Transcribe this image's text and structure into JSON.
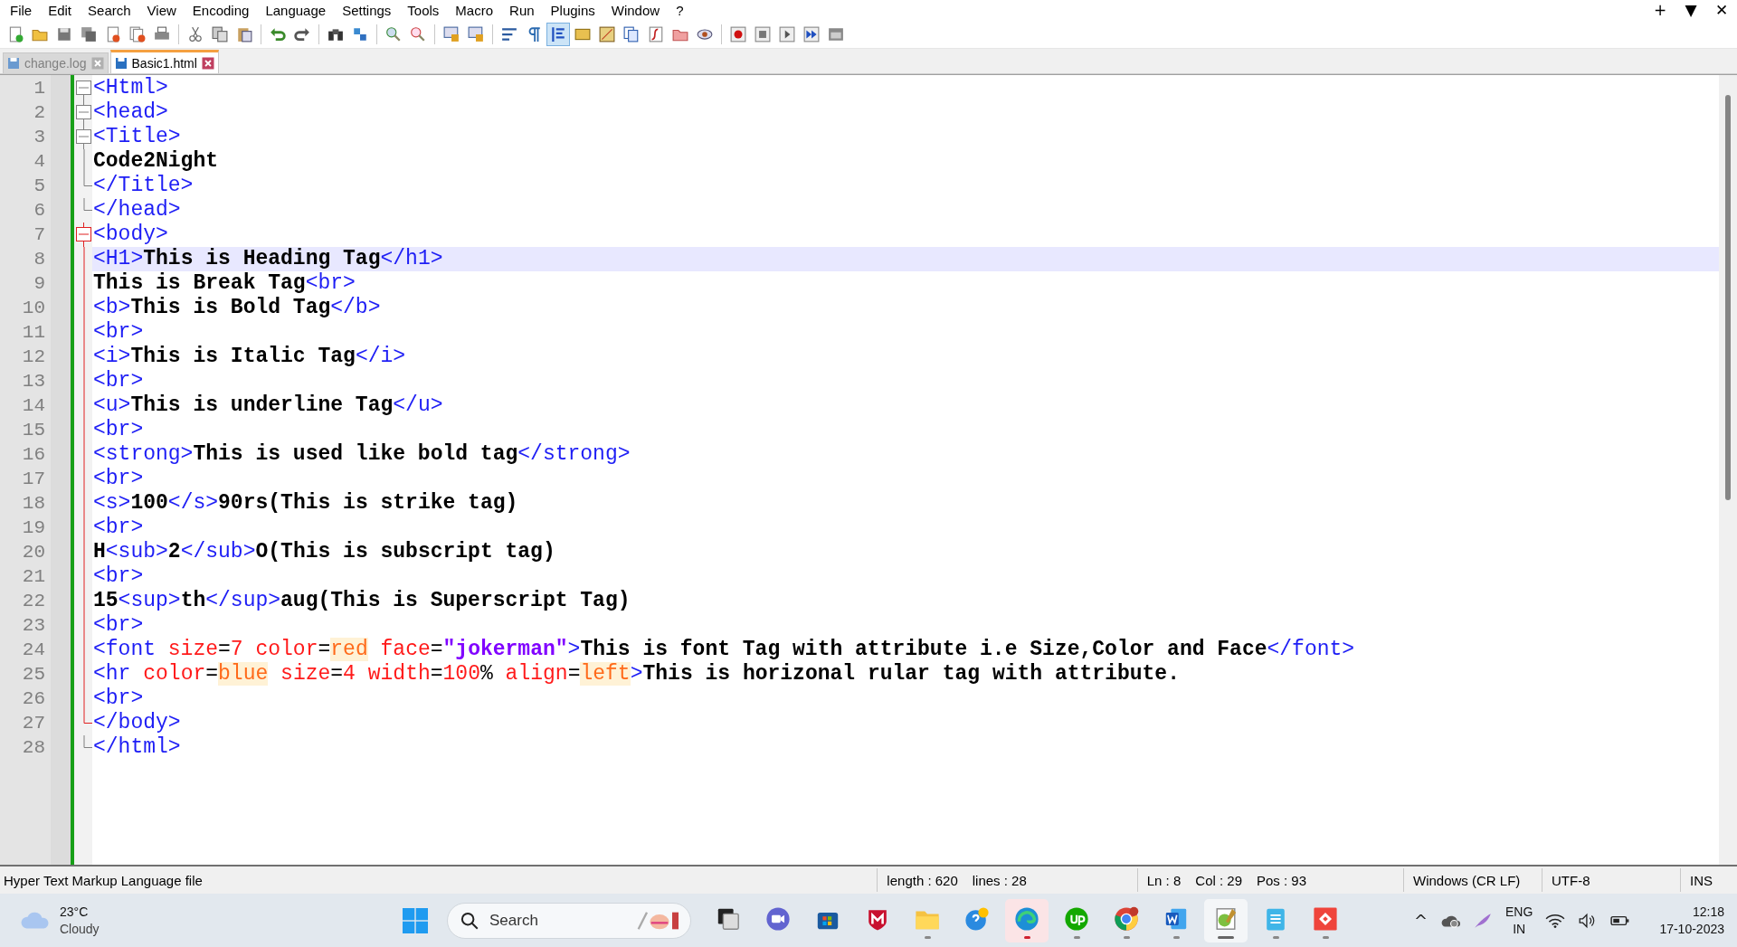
{
  "menu": [
    "File",
    "Edit",
    "Search",
    "View",
    "Encoding",
    "Language",
    "Settings",
    "Tools",
    "Macro",
    "Run",
    "Plugins",
    "Window",
    "?"
  ],
  "window_controls": [
    "+",
    "▼",
    "✕"
  ],
  "toolbar_buttons": [
    {
      "pressed": false
    },
    {
      "pressed": false
    },
    {
      "pressed": false
    },
    {
      "pressed": false
    },
    {
      "pressed": false
    },
    {
      "pressed": false
    },
    {
      "pressed": false
    },
    {
      "pressed": false
    },
    {
      "pressed": false
    },
    {
      "pressed": false
    },
    {
      "pressed": false
    },
    {
      "pressed": false
    },
    {
      "pressed": false
    },
    {
      "pressed": false
    },
    {
      "pressed": false
    },
    {
      "pressed": false
    },
    {
      "pressed": false
    },
    {
      "pressed": false
    },
    {
      "pressed": false
    },
    {
      "pressed": false
    },
    {
      "pressed": true
    },
    {
      "pressed": false
    },
    {
      "pressed": false
    },
    {
      "pressed": false
    },
    {
      "pressed": false
    },
    {
      "pressed": false
    },
    {
      "pressed": false
    },
    {
      "pressed": false
    },
    {
      "pressed": false
    },
    {
      "pressed": false
    },
    {
      "pressed": false
    },
    {
      "pressed": false
    }
  ],
  "tabs": [
    {
      "label": "change.log",
      "selected": false
    },
    {
      "label": "Basic1.html",
      "selected": true
    }
  ],
  "lines": [
    {
      "number": "1",
      "current": false,
      "fold_start": true,
      "fold_active": false,
      "tokens": [
        {
          "kind": "tag",
          "text": "<Html>"
        }
      ]
    },
    {
      "number": "2",
      "current": false,
      "fold_start": true,
      "fold_active": false,
      "tokens": [
        {
          "kind": "tag",
          "text": "<head>"
        }
      ]
    },
    {
      "number": "3",
      "current": false,
      "fold_start": true,
      "fold_active": false,
      "tokens": [
        {
          "kind": "tag",
          "text": "<Title>"
        }
      ]
    },
    {
      "number": "4",
      "current": false,
      "fold_start": false,
      "fold_end": false,
      "fold_active": false,
      "tokens": [
        {
          "kind": "text",
          "text": "Code2Night"
        }
      ]
    },
    {
      "number": "5",
      "current": false,
      "fold_start": false,
      "fold_end": true,
      "fold_active": false,
      "tokens": [
        {
          "kind": "tag",
          "text": "</Title>"
        }
      ]
    },
    {
      "number": "6",
      "current": false,
      "fold_start": false,
      "fold_end": true,
      "fold_active": false,
      "tokens": [
        {
          "kind": "tag",
          "text": "</head>"
        }
      ]
    },
    {
      "number": "7",
      "current": false,
      "fold_start": true,
      "fold_active": true,
      "tokens": [
        {
          "kind": "tag",
          "text": "<body>"
        }
      ]
    },
    {
      "number": "8",
      "current": true,
      "fold_start": false,
      "fold_end": false,
      "fold_active": true,
      "tokens": [
        {
          "kind": "tag",
          "text": "<H1>"
        },
        {
          "kind": "text",
          "text": "This is Heading Tag"
        },
        {
          "kind": "tag",
          "text": "</h1>"
        }
      ]
    },
    {
      "number": "9",
      "current": false,
      "fold_start": false,
      "fold_end": false,
      "fold_active": true,
      "tokens": [
        {
          "kind": "text",
          "text": "This is Break Tag"
        },
        {
          "kind": "tag",
          "text": "<br>"
        }
      ]
    },
    {
      "number": "10",
      "current": false,
      "fold_start": false,
      "fold_end": false,
      "fold_active": true,
      "tokens": [
        {
          "kind": "tag",
          "text": "<b>"
        },
        {
          "kind": "text",
          "text": "This is Bold Tag"
        },
        {
          "kind": "tag",
          "text": "</b>"
        }
      ]
    },
    {
      "number": "11",
      "current": false,
      "fold_start": false,
      "fold_end": false,
      "fold_active": true,
      "tokens": [
        {
          "kind": "tag",
          "text": "<br>"
        }
      ]
    },
    {
      "number": "12",
      "current": false,
      "fold_start": false,
      "fold_end": false,
      "fold_active": true,
      "tokens": [
        {
          "kind": "tag",
          "text": "<i>"
        },
        {
          "kind": "text",
          "text": "This is Italic Tag"
        },
        {
          "kind": "tag",
          "text": "</i>"
        }
      ]
    },
    {
      "number": "13",
      "current": false,
      "fold_start": false,
      "fold_end": false,
      "fold_active": true,
      "tokens": [
        {
          "kind": "tag",
          "text": "<br>"
        }
      ]
    },
    {
      "number": "14",
      "current": false,
      "fold_start": false,
      "fold_end": false,
      "fold_active": true,
      "tokens": [
        {
          "kind": "tag",
          "text": "<u>"
        },
        {
          "kind": "text",
          "text": "This is underline Tag"
        },
        {
          "kind": "tag",
          "text": "</u>"
        }
      ]
    },
    {
      "number": "15",
      "current": false,
      "fold_start": false,
      "fold_end": false,
      "fold_active": true,
      "tokens": [
        {
          "kind": "tag",
          "text": "<br>"
        }
      ]
    },
    {
      "number": "16",
      "current": false,
      "fold_start": false,
      "fold_end": false,
      "fold_active": true,
      "tokens": [
        {
          "kind": "tag",
          "text": "<strong>"
        },
        {
          "kind": "text",
          "text": "This is used like bold tag"
        },
        {
          "kind": "tag",
          "text": "</strong>"
        }
      ]
    },
    {
      "number": "17",
      "current": false,
      "fold_start": false,
      "fold_end": false,
      "fold_active": true,
      "tokens": [
        {
          "kind": "tag",
          "text": "<br>"
        }
      ]
    },
    {
      "number": "18",
      "current": false,
      "fold_start": false,
      "fold_end": false,
      "fold_active": true,
      "tokens": [
        {
          "kind": "tag",
          "text": "<s>"
        },
        {
          "kind": "text",
          "text": "100"
        },
        {
          "kind": "tag",
          "text": "</s>"
        },
        {
          "kind": "text",
          "text": "90rs(This is strike tag)"
        }
      ]
    },
    {
      "number": "19",
      "current": false,
      "fold_start": false,
      "fold_end": false,
      "fold_active": true,
      "tokens": [
        {
          "kind": "tag",
          "text": "<br>"
        }
      ]
    },
    {
      "number": "20",
      "current": false,
      "fold_start": false,
      "fold_end": false,
      "fold_active": true,
      "tokens": [
        {
          "kind": "text",
          "text": "H"
        },
        {
          "kind": "tag",
          "text": "<sub>"
        },
        {
          "kind": "text",
          "text": "2"
        },
        {
          "kind": "tag",
          "text": "</sub>"
        },
        {
          "kind": "text",
          "text": "O(This is subscript tag)"
        }
      ]
    },
    {
      "number": "21",
      "current": false,
      "fold_start": false,
      "fold_end": false,
      "fold_active": true,
      "tokens": [
        {
          "kind": "tag",
          "text": "<br>"
        }
      ]
    },
    {
      "number": "22",
      "current": false,
      "fold_start": false,
      "fold_end": false,
      "fold_active": true,
      "tokens": [
        {
          "kind": "text",
          "text": "15"
        },
        {
          "kind": "tag",
          "text": "<sup>"
        },
        {
          "kind": "text",
          "text": "th"
        },
        {
          "kind": "tag",
          "text": "</sup>"
        },
        {
          "kind": "text",
          "text": "aug(This is Superscript Tag)"
        }
      ]
    },
    {
      "number": "23",
      "current": false,
      "fold_start": false,
      "fold_end": false,
      "fold_active": true,
      "tokens": [
        {
          "kind": "tag",
          "text": "<br>"
        }
      ]
    },
    {
      "number": "24",
      "current": false,
      "fold_start": false,
      "fold_end": false,
      "fold_active": true,
      "tokens": [
        {
          "kind": "tag",
          "text": "<font"
        },
        {
          "kind": "attr",
          "text": " size"
        },
        {
          "kind": "op",
          "text": "="
        },
        {
          "kind": "value",
          "text": "7"
        },
        {
          "kind": "attr",
          "text": " color"
        },
        {
          "kind": "op",
          "text": "="
        },
        {
          "kind": "hvalue",
          "text": "red"
        },
        {
          "kind": "attr",
          "text": " face"
        },
        {
          "kind": "op",
          "text": "="
        },
        {
          "kind": "string",
          "text": "\"jokerman\""
        },
        {
          "kind": "tag",
          "text": ">"
        },
        {
          "kind": "text",
          "text": "This is font Tag with attribute i.e Size,Color and Face"
        },
        {
          "kind": "tag",
          "text": "</font>"
        }
      ]
    },
    {
      "number": "25",
      "current": false,
      "fold_start": false,
      "fold_end": false,
      "fold_active": true,
      "tokens": [
        {
          "kind": "tag",
          "text": "<hr"
        },
        {
          "kind": "attr",
          "text": " color"
        },
        {
          "kind": "op",
          "text": "="
        },
        {
          "kind": "hvalue",
          "text": "blue"
        },
        {
          "kind": "attr",
          "text": " size"
        },
        {
          "kind": "op",
          "text": "="
        },
        {
          "kind": "value",
          "text": "4"
        },
        {
          "kind": "attr",
          "text": " width"
        },
        {
          "kind": "op",
          "text": "="
        },
        {
          "kind": "value",
          "text": "100"
        },
        {
          "kind": "op",
          "text": "%"
        },
        {
          "kind": "attr",
          "text": " align"
        },
        {
          "kind": "op",
          "text": "="
        },
        {
          "kind": "hvalue",
          "text": "left"
        },
        {
          "kind": "tag",
          "text": ">"
        },
        {
          "kind": "text",
          "text": "This is horizonal rular tag with attribute."
        }
      ]
    },
    {
      "number": "26",
      "current": false,
      "fold_start": false,
      "fold_end": false,
      "fold_active": true,
      "tokens": [
        {
          "kind": "tag",
          "text": "<br>"
        }
      ]
    },
    {
      "number": "27",
      "current": false,
      "fold_start": false,
      "fold_end": true,
      "fold_active": true,
      "tokens": [
        {
          "kind": "tag",
          "text": "</body>"
        }
      ]
    },
    {
      "number": "28",
      "current": false,
      "fold_start": false,
      "fold_end": true,
      "fold_active": false,
      "tokens": [
        {
          "kind": "tag",
          "text": "</html>"
        }
      ]
    }
  ],
  "status_bar": {
    "file_type": "Hyper Text Markup Language file",
    "length": "length : 620",
    "lines": "lines : 28",
    "ln": "Ln : 8",
    "col": "Col : 29",
    "pos": "Pos : 93",
    "eol": "Windows (CR LF)",
    "encoding": "UTF-8",
    "mode": "INS"
  },
  "taskbar": {
    "temperature": "23°C",
    "weather": "Cloudy",
    "search": {
      "placeholder": "Search"
    },
    "apps": [
      {
        "running": false,
        "selected": false,
        "attention": false
      },
      {
        "running": false,
        "selected": false,
        "attention": false
      },
      {
        "running": false,
        "selected": false,
        "attention": false
      },
      {
        "running": false,
        "selected": false,
        "attention": false
      },
      {
        "running": true,
        "selected": false,
        "attention": false
      },
      {
        "running": false,
        "selected": false,
        "attention": false
      },
      {
        "running": true,
        "selected": false,
        "attention": true
      },
      {
        "running": true,
        "selected": false,
        "attention": false
      },
      {
        "running": true,
        "selected": false,
        "attention": false
      },
      {
        "running": true,
        "selected": false,
        "attention": false
      },
      {
        "running": true,
        "selected": true,
        "attention": false
      },
      {
        "running": true,
        "selected": false,
        "attention": false
      },
      {
        "running": true,
        "selected": false,
        "attention": false
      }
    ],
    "tray_caret": "^",
    "language": "ENG",
    "region": "IN",
    "time": "12:18",
    "date": "17-10-2023"
  }
}
